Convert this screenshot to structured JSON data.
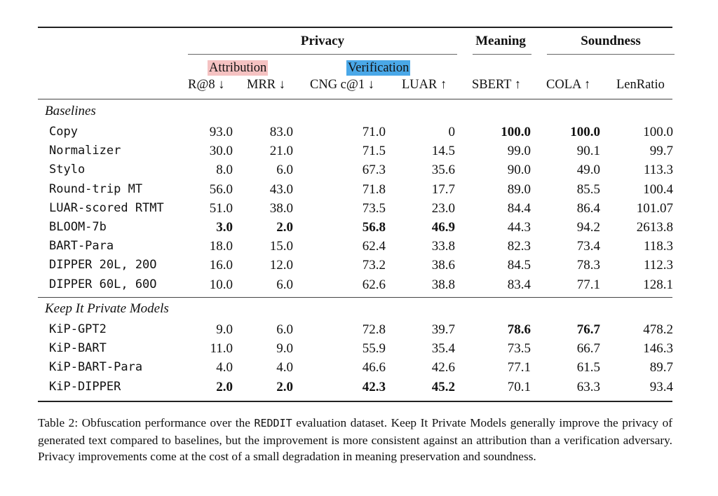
{
  "table": {
    "group_headers": {
      "privacy": "Privacy",
      "meaning": "Meaning",
      "soundness": "Soundness"
    },
    "sub_headers": {
      "attribution": "Attribution",
      "verification": "Verification"
    },
    "highlight_colors": {
      "attribution": "#f5c2c2",
      "verification": "#4aa8e8"
    },
    "columns": [
      "R@8 ↓",
      "MRR ↓",
      "CNG c@1 ↓",
      "LUAR ↑",
      "SBERT ↑",
      "COLA ↑",
      "LenRatio"
    ],
    "sections": [
      {
        "title": "Baselines",
        "rows": [
          {
            "name": "Copy",
            "values": [
              "93.0",
              "83.0",
              "71.0",
              "0",
              "100.0",
              "100.0",
              "100.0"
            ],
            "bold": [
              false,
              false,
              false,
              false,
              true,
              true,
              false
            ]
          },
          {
            "name": "Normalizer",
            "values": [
              "30.0",
              "21.0",
              "71.5",
              "14.5",
              "99.0",
              "90.1",
              "99.7"
            ],
            "bold": [
              false,
              false,
              false,
              false,
              false,
              false,
              false
            ]
          },
          {
            "name": "Stylo",
            "values": [
              "8.0",
              "6.0",
              "67.3",
              "35.6",
              "90.0",
              "49.0",
              "113.3"
            ],
            "bold": [
              false,
              false,
              false,
              false,
              false,
              false,
              false
            ]
          },
          {
            "name": "Round-trip MT",
            "values": [
              "56.0",
              "43.0",
              "71.8",
              "17.7",
              "89.0",
              "85.5",
              "100.4"
            ],
            "bold": [
              false,
              false,
              false,
              false,
              false,
              false,
              false
            ]
          },
          {
            "name": "LUAR-scored RTMT",
            "values": [
              "51.0",
              "38.0",
              "73.5",
              "23.0",
              "84.4",
              "86.4",
              "101.07"
            ],
            "bold": [
              false,
              false,
              false,
              false,
              false,
              false,
              false
            ]
          },
          {
            "name": "BLOOM-7b",
            "values": [
              "3.0",
              "2.0",
              "56.8",
              "46.9",
              "44.3",
              "94.2",
              "2613.8"
            ],
            "bold": [
              true,
              true,
              true,
              true,
              false,
              false,
              false
            ]
          },
          {
            "name": "BART-Para",
            "values": [
              "18.0",
              "15.0",
              "62.4",
              "33.8",
              "82.3",
              "73.4",
              "118.3"
            ],
            "bold": [
              false,
              false,
              false,
              false,
              false,
              false,
              false
            ]
          },
          {
            "name": "DIPPER 20L, 20O",
            "values": [
              "16.0",
              "12.0",
              "73.2",
              "38.6",
              "84.5",
              "78.3",
              "112.3"
            ],
            "bold": [
              false,
              false,
              false,
              false,
              false,
              false,
              false
            ]
          },
          {
            "name": "DIPPER 60L, 60O",
            "values": [
              "10.0",
              "6.0",
              "62.6",
              "38.8",
              "83.4",
              "77.1",
              "128.1"
            ],
            "bold": [
              false,
              false,
              false,
              false,
              false,
              false,
              false
            ]
          }
        ]
      },
      {
        "title": "Keep It Private Models",
        "rows": [
          {
            "name": "KiP-GPT2",
            "values": [
              "9.0",
              "6.0",
              "72.8",
              "39.7",
              "78.6",
              "76.7",
              "478.2"
            ],
            "bold": [
              false,
              false,
              false,
              false,
              true,
              true,
              false
            ]
          },
          {
            "name": "KiP-BART",
            "values": [
              "11.0",
              "9.0",
              "55.9",
              "35.4",
              "73.5",
              "66.7",
              "146.3"
            ],
            "bold": [
              false,
              false,
              false,
              false,
              false,
              false,
              false
            ]
          },
          {
            "name": "KiP-BART-Para",
            "values": [
              "4.0",
              "4.0",
              "46.6",
              "42.6",
              "77.1",
              "61.5",
              "89.7"
            ],
            "bold": [
              false,
              false,
              false,
              false,
              false,
              false,
              false
            ]
          },
          {
            "name": "KiP-DIPPER",
            "values": [
              "2.0",
              "2.0",
              "42.3",
              "45.2",
              "70.1",
              "63.3",
              "93.4"
            ],
            "bold": [
              true,
              true,
              true,
              true,
              false,
              false,
              false
            ]
          }
        ]
      }
    ]
  },
  "caption": {
    "prefix": "Table 2: Obfuscation performance over the ",
    "dataset": "REDDIT",
    "suffix": " evaluation dataset.  Keep It Private Models generally improve the privacy of generated text compared to baselines, but the improvement is more consistent against an attribution than a verification adversary. Privacy improvements come at the cost of a small degradation in meaning preservation and soundness."
  }
}
